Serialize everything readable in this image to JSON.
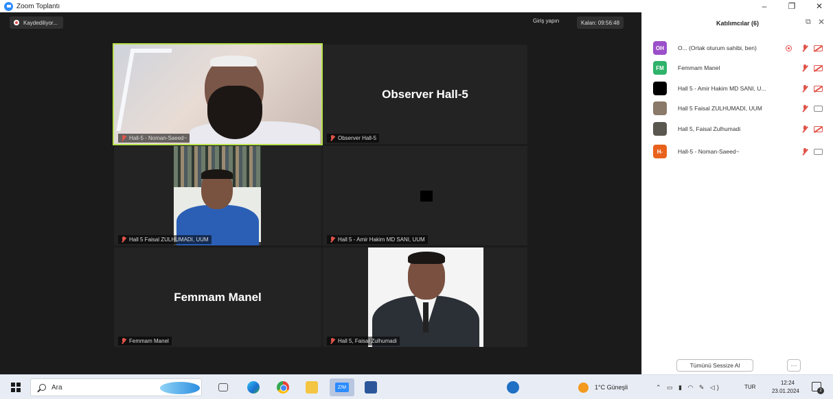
{
  "window": {
    "title": "Zoom Toplantı",
    "minimize": "–",
    "restore": "❐",
    "close": "✕"
  },
  "toolbar": {
    "recording_label": "Kaydediliyor...",
    "signin_label": "Giriş yapın",
    "timer_label": "Kalan: 09:56:48"
  },
  "tiles": [
    {
      "name": "Hall-5 - Noman-Saeed~",
      "big_name": ""
    },
    {
      "name": "Observer Hall-5",
      "big_name": "Observer Hall-5"
    },
    {
      "name": "Hall 5 Faisal ZULHUMADI, UUM",
      "big_name": ""
    },
    {
      "name": "Hall 5 - Amir Hakim MD SANI, UUM",
      "big_name": ""
    },
    {
      "name": "Femmam Manel",
      "big_name": "Femmam Manel"
    },
    {
      "name": "Hall 5, Faisal Zulhumadi",
      "big_name": ""
    }
  ],
  "panel": {
    "title": "Katılımcılar (6)",
    "popout_icon": "⧉",
    "close_icon": "✕",
    "participants": [
      {
        "initials": "OH",
        "name": "O... (Ortak oturum sahibi, ben)",
        "avatar_color": "#9b4fc9",
        "camera": "off",
        "recording": true
      },
      {
        "initials": "FM",
        "name": "Femmam Manel",
        "avatar_color": "#2fb36b",
        "camera": "off",
        "recording": false
      },
      {
        "initials": "",
        "name": "Hall 5 - Amir Hakim MD SANI, U...",
        "avatar_color": "#000000",
        "camera": "off",
        "recording": false
      },
      {
        "initials": "",
        "name": "Hall 5 Faisal ZULHUMADI, UUM",
        "avatar_color": "#8a7a6a",
        "camera": "on",
        "recording": false
      },
      {
        "initials": "",
        "name": "Hall 5, Faisal Zulhumadi",
        "avatar_color": "#5a5650",
        "camera": "off",
        "recording": false
      },
      {
        "initials": "H-",
        "name": "Hall-5 - Noman-Saeed~",
        "avatar_color": "#e8621c",
        "camera": "on",
        "recording": false
      }
    ],
    "mute_all_label": "Tümünü Sessize Al",
    "more_label": "···"
  },
  "taskbar": {
    "search_placeholder": "Ara",
    "weather": "1°C Güneşli",
    "tray_icons": "⌃ ▭ ▮ ◠ ✎ ◁)",
    "language": "TUR",
    "time": "12:24",
    "date": "23.01.2024",
    "notification_count": "2"
  },
  "colors": {
    "active_speaker_border": "#b7e04a",
    "stage_background": "#1b1b1b",
    "mute_red": "#e0544a"
  }
}
